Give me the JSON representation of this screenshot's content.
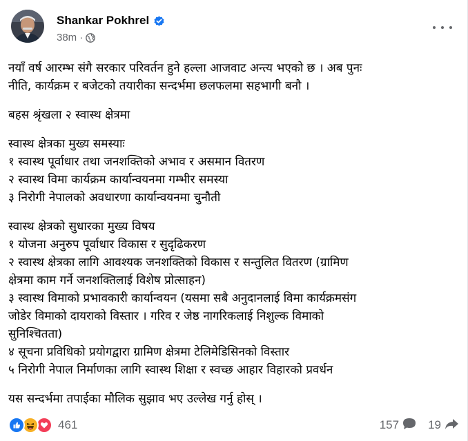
{
  "author": {
    "name": "Shankar Pokhrel",
    "timestamp": "38m",
    "separator": "·"
  },
  "icons": {
    "avatar": "avatar",
    "verified": "verified-badge-icon",
    "audience": "globe-icon",
    "more": "more-options-icon",
    "like": "like-reaction-icon",
    "haha": "haha-reaction-icon",
    "love": "love-reaction-icon",
    "comment": "comment-icon",
    "share": "share-icon"
  },
  "colors": {
    "verified": "#1877f2",
    "like": "#1877f2",
    "haha": "#f7b125",
    "love": "#f33e58",
    "secondary_text": "#65676b"
  },
  "post": {
    "p1": [
      "नयाँ वर्ष आरम्भ संगै सरकार परिवर्तन हुने हल्ला आजवाट अन्त्य भएको छ । अब पुनः",
      "नीति, कार्यक्रम र बजेटको तयारीका सन्दर्भमा छलफलमा सहभागी बनौ ।"
    ],
    "p2": [
      "बहस श्रृंखला २ स्वास्थ क्षेत्रमा"
    ],
    "p3": [
      "स्वास्थ क्षेत्रका मुख्य समस्याः",
      "१ स्वास्थ पूर्वाधार तथा जनशक्तिको अभाव र असमान वितरण",
      "२ स्वास्थ विमा कार्यक्रम कार्यान्वयनमा गम्भीर समस्या",
      "३ निरोगी नेपालको अवधारणा कार्यान्वयनमा चुनौती"
    ],
    "p4": [
      "स्वास्थ क्षेत्रको सुधारका मुख्य विषय",
      "१ योजना अनुरुप पूर्वाधार विकास र सुदृढिकरण",
      "२ स्वास्थ क्षेत्रका लागि आवश्यक जनशक्तिको विकास र सन्तुलित वितरण (ग्रामिण",
      "क्षेत्रमा काम गर्ने जनशक्तिलाई विशेष प्रोत्साहन)",
      "३ स्वास्थ विमाको प्रभावकारी कार्यान्वयन (यसमा सबै अनुदानलाई विमा कार्यक्रमसंग",
      "जोडेर विमाको दायराको विस्तार । गरिव र जेष्ठ नागरिकलाई निशुल्क विमाको",
      "सुनिश्चितता)",
      "४ सूचना प्रविधिको प्रयोगद्वारा ग्रामिण क्षेत्रमा टेलिमेडिसिनको विस्तार",
      "५ निरोगी नेपाल निर्माणका लागि स्वास्थ शिक्षा र स्वच्छ आहार विहारको प्रवर्धन"
    ],
    "p5": [
      "यस सन्दर्भमा तपाईका मौलिक सुझाव भए उल्लेख गर्नु होस् ।"
    ]
  },
  "stats": {
    "reactions": "461",
    "comments": "157",
    "shares": "19"
  }
}
